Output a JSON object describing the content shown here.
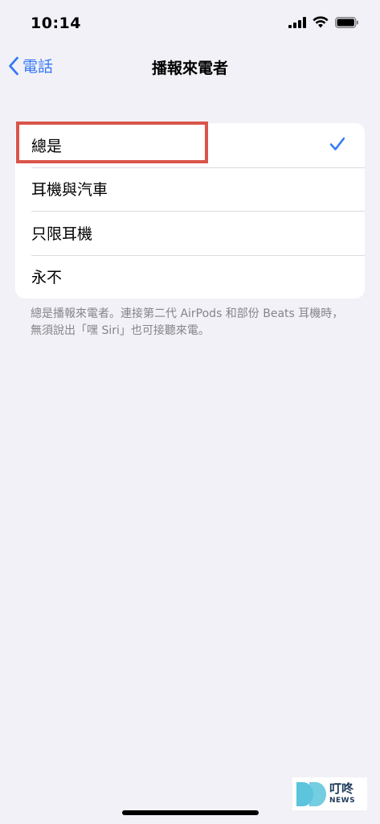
{
  "status_bar": {
    "time": "10:14"
  },
  "nav": {
    "back_label": "電話",
    "title": "播報來電者"
  },
  "options": [
    {
      "label": "總是",
      "selected": true
    },
    {
      "label": "耳機與汽車",
      "selected": false
    },
    {
      "label": "只限耳機",
      "selected": false
    },
    {
      "label": "永不",
      "selected": false
    }
  ],
  "footer_note": "總是播報來電者。連接第二代 AirPods 和部份 Beats 耳機時，無須說出「嘿 Siri」也可接聽來電。",
  "watermark": {
    "chinese": "叮咚",
    "english": "NEWS"
  },
  "colors": {
    "accent": "#3478f6",
    "highlight": "#d9554a",
    "background": "#f2f1f7"
  },
  "icons": {
    "back": "chevron-left-icon",
    "check": "checkmark-icon",
    "signal": "cellular-signal-icon",
    "wifi": "wifi-icon",
    "battery": "battery-icon"
  }
}
